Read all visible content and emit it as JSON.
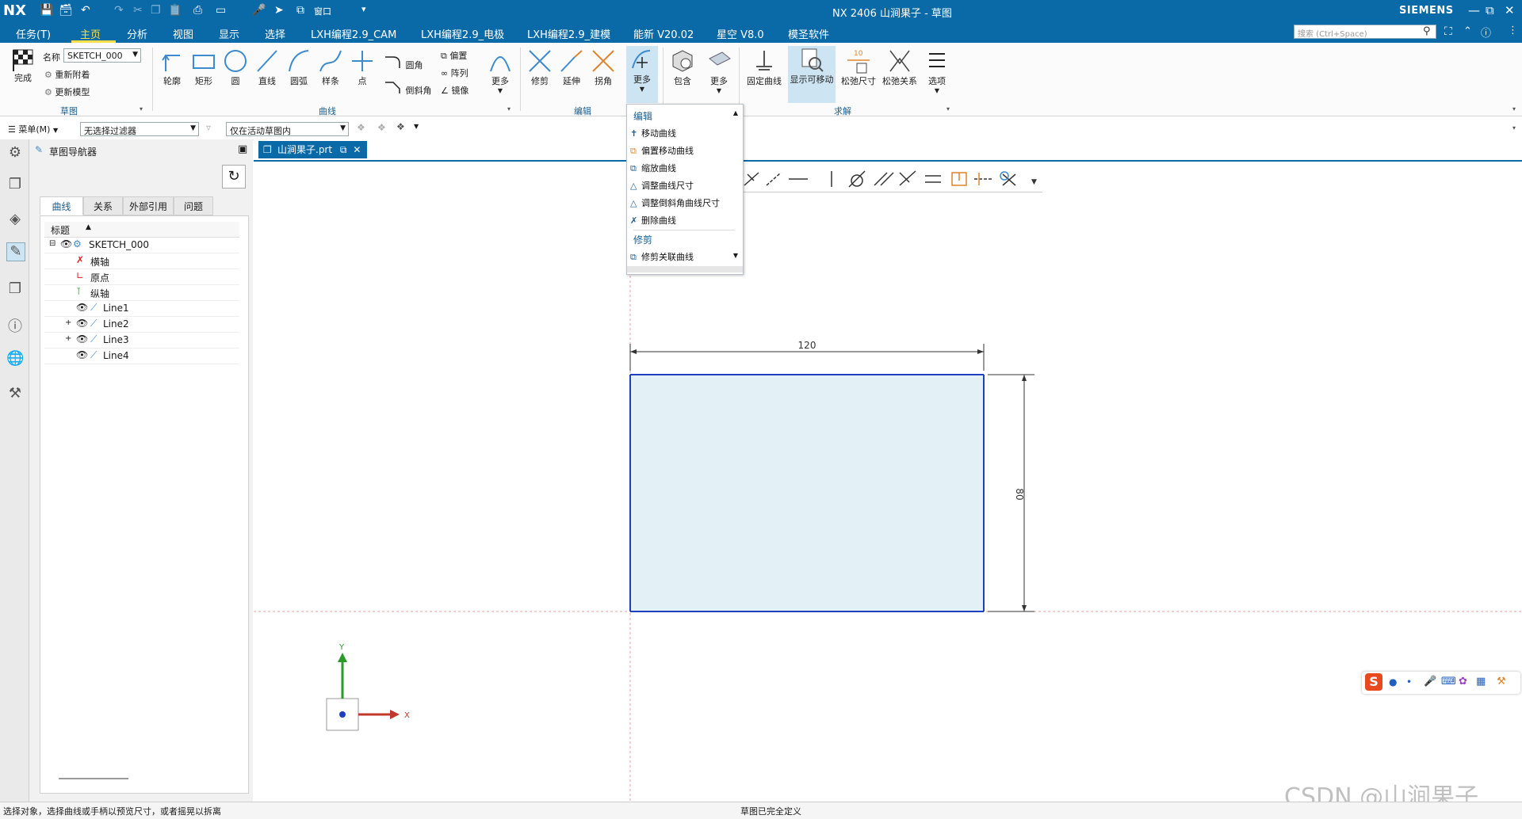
{
  "titlebar": {
    "logo": "NX",
    "title": "NX 2406 山涧果子 - 草图",
    "brand": "SIEMENS",
    "window_menu": "窗口"
  },
  "menu": {
    "tabs": [
      "任务(T)",
      "主页",
      "分析",
      "视图",
      "显示",
      "选择",
      "LXH编程2.9_CAM",
      "LXH编程2.9_电极",
      "LXH编程2.9_建模",
      "能新 V20.02",
      "星空 V8.0",
      "模圣软件"
    ],
    "active": "主页",
    "search_placeholder": "搜索 (Ctrl+Space)"
  },
  "ribbon": {
    "finish": "完成",
    "name_label": "名称",
    "sketch_name": "SKETCH_000",
    "reattach": "重新附着",
    "update_model": "更新模型",
    "group_sketch": "草图",
    "curve_buttons": [
      "轮廓",
      "矩形",
      "圆",
      "直线",
      "圆弧",
      "样条",
      "点"
    ],
    "fillet": "圆角",
    "chamfer": "倒斜角",
    "offset": "偏置",
    "pattern": "阵列",
    "mirror": "镜像",
    "more": "更多",
    "group_curve": "曲线",
    "trim": "修剪",
    "extend": "延伸",
    "corner": "拐角",
    "more_edit": "更多",
    "group_edit": "编辑",
    "include": "包含",
    "more2": "更多",
    "fix_curve": "固定曲线",
    "show_movable": "显示可移动",
    "relax_dim": "松弛尺寸",
    "relax_rel": "松弛关系",
    "options": "选项",
    "group_solve": "求解"
  },
  "toolbar2": {
    "menu": "菜单(M)",
    "filter": "无选择过滤器",
    "scope": "仅在活动草图内"
  },
  "navigator": {
    "title": "草图导航器",
    "tabs": [
      "曲线",
      "关系",
      "外部引用",
      "问题"
    ],
    "column": "标题",
    "rows": [
      {
        "label": "SKETCH_000"
      },
      {
        "label": "横轴"
      },
      {
        "label": "原点"
      },
      {
        "label": "纵轴"
      },
      {
        "label": "Line1"
      },
      {
        "label": "Line2"
      },
      {
        "label": "Line3"
      },
      {
        "label": "Line4"
      }
    ]
  },
  "document": {
    "tab": "山涧果子.prt"
  },
  "dropdown": {
    "section_edit": "编辑",
    "edit_items": [
      "移动曲线",
      "偏置移动曲线",
      "缩放曲线",
      "调整曲线尺寸",
      "调整倒斜角曲线尺寸",
      "删除曲线"
    ],
    "section_trim": "修剪",
    "trim_items": [
      "修剪关联曲线"
    ]
  },
  "sketch": {
    "dim_horizontal": "120",
    "dim_vertical": "80",
    "axis_x": "X",
    "axis_y": "Y"
  },
  "status": {
    "left": "选择对象，选择曲线或手柄以预览尺寸，或者摇晃以拆离",
    "center": "草图已完全定义"
  },
  "watermark": "CSDN @山涧果子",
  "colors": {
    "titlebar": "#0a6aa8",
    "active_tab": "#ffe04a",
    "sketch_line": "#1f3fbf",
    "sketch_fill": "#e3f1f6"
  }
}
